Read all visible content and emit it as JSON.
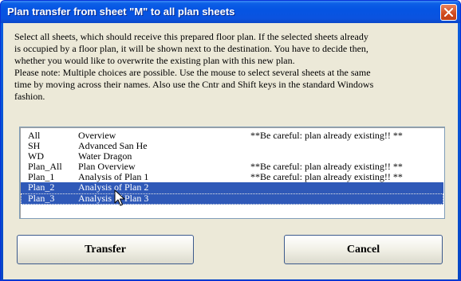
{
  "window": {
    "title": "Plan transfer from sheet \"M\" to all plan sheets"
  },
  "description": {
    "lines": [
      "Select all sheets, which should receive this prepared floor plan. If the selected sheets already",
      "is occupied by a floor plan, it will be shown next to the destination. You have to decide then,",
      "whether you would like to overwrite the existing plan with this new plan.",
      "Please note: Multiple choices are possible. Use the mouse to select several sheets at the same",
      "time by moving across their names. Also use the Cntr and Shift keys in the standard Windows",
      "fashion."
    ]
  },
  "sheets": [
    {
      "code": "All",
      "name": "Overview",
      "note": "**Be careful: plan already existing!! **",
      "selected": false
    },
    {
      "code": "SH",
      "name": "Advanced San He",
      "note": "",
      "selected": false
    },
    {
      "code": "WD",
      "name": "Water Dragon",
      "note": "",
      "selected": false
    },
    {
      "code": "Plan_All",
      "name": "Plan Overview",
      "note": "**Be careful: plan already existing!! **",
      "selected": false
    },
    {
      "code": "Plan_1",
      "name": "Analysis of Plan 1",
      "note": "**Be careful: plan already existing!! **",
      "selected": false
    },
    {
      "code": "Plan_2",
      "name": "Analysis of Plan 2",
      "note": "",
      "selected": true
    },
    {
      "code": "Plan_3",
      "name": "Analysis of Plan 3",
      "note": "",
      "selected": true
    }
  ],
  "buttons": {
    "transfer": "Transfer",
    "cancel": "Cancel"
  },
  "colors": {
    "titlebar": "#0554e3",
    "selection": "#2f59b8",
    "dialog_face": "#ece9d8",
    "close_button": "#d04a1e"
  }
}
